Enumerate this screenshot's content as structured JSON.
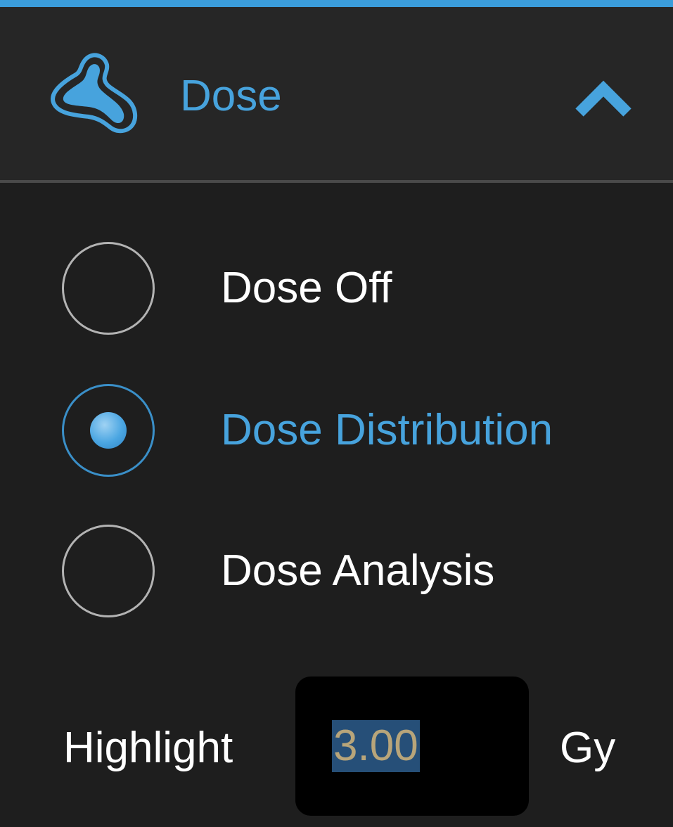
{
  "colors": {
    "accent": "#3b9ddb",
    "accent_text": "#47a3dd",
    "background": "#1e1e1e",
    "header_background": "#262626",
    "text": "#ffffff",
    "field_background": "#000000",
    "selection": "#264f78"
  },
  "header": {
    "icon": "dose-blob-icon",
    "title": "Dose",
    "collapse_icon": "chevron-up-icon"
  },
  "dose_mode": {
    "options": [
      {
        "label": "Dose Off",
        "selected": false
      },
      {
        "label": "Dose Distribution",
        "selected": true
      },
      {
        "label": "Dose Analysis",
        "selected": false
      }
    ]
  },
  "highlight": {
    "label": "Highlight",
    "value": "3.00",
    "unit": "Gy"
  }
}
